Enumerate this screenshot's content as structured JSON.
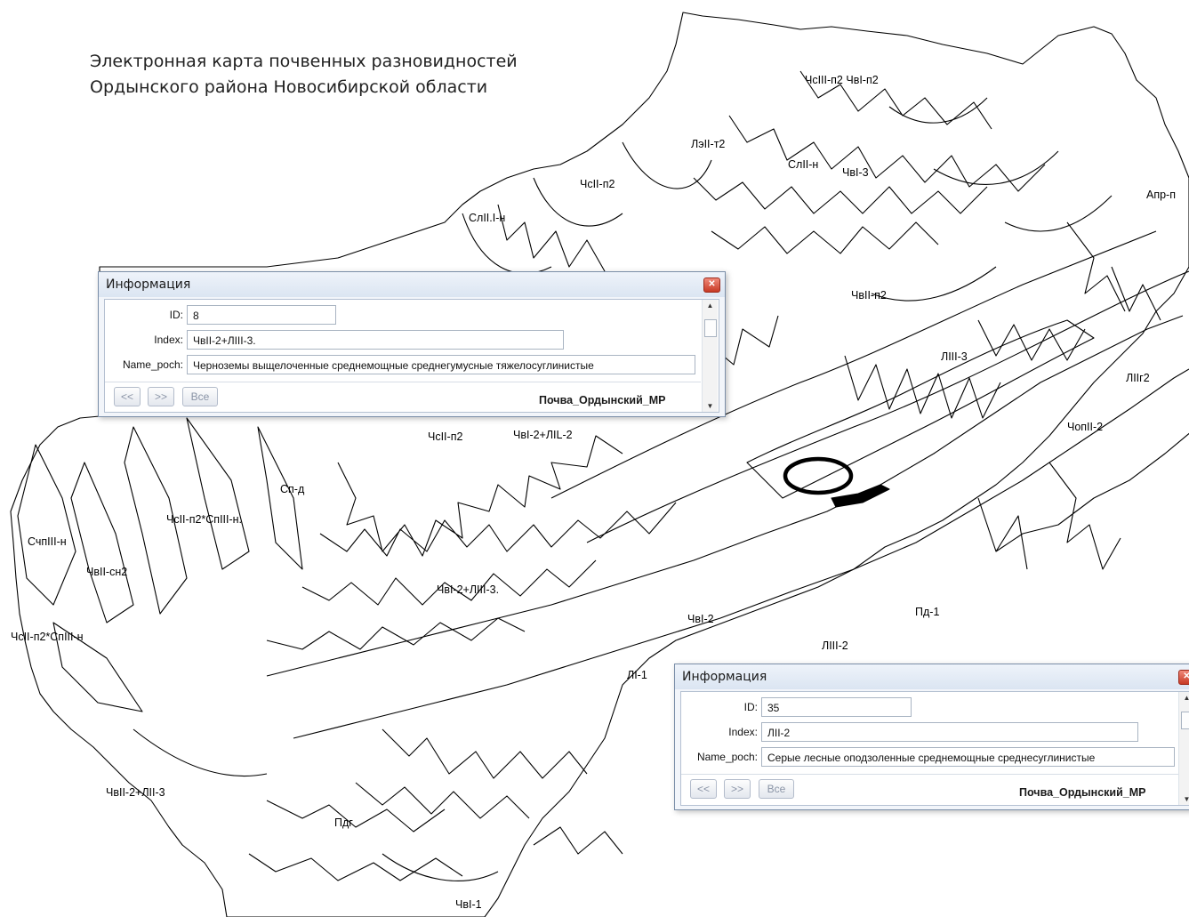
{
  "title": {
    "line1": "Электронная карта почвенных разновидностей",
    "line2": "Ордынского района Новосибирской области"
  },
  "map_labels": [
    {
      "id": "l1",
      "text": "ЧсIII-п2 ЧвI-п2"
    },
    {
      "id": "l2",
      "text": "ЛэII-т2"
    },
    {
      "id": "l3",
      "text": "СлII-н"
    },
    {
      "id": "l4",
      "text": "ЧвI-3"
    },
    {
      "id": "l5",
      "text": "ЧсII-п2"
    },
    {
      "id": "l6",
      "text": "Апр-п"
    },
    {
      "id": "l7",
      "text": "СлII.I-н"
    },
    {
      "id": "l8",
      "text": "ЧвII-п2"
    },
    {
      "id": "l9",
      "text": "ЛIII-3"
    },
    {
      "id": "l10",
      "text": "ЛIIг2"
    },
    {
      "id": "l11",
      "text": "ЧсII-п2"
    },
    {
      "id": "l12",
      "text": "ЧвI-2+ЛIL-2"
    },
    {
      "id": "l13",
      "text": "ЧопII-2"
    },
    {
      "id": "l14",
      "text": "Сп-д"
    },
    {
      "id": "l15",
      "text": "ЧсII-п2*СпIII-н."
    },
    {
      "id": "l16",
      "text": "СчпIII-н"
    },
    {
      "id": "l17",
      "text": "ЧвII-сн2"
    },
    {
      "id": "l18",
      "text": "ЧвI-2+ЛIII-3."
    },
    {
      "id": "l19",
      "text": "ЧвI-2"
    },
    {
      "id": "l20",
      "text": "Пд-1"
    },
    {
      "id": "l21",
      "text": "ЧсII-п2*СпIII-н"
    },
    {
      "id": "l22",
      "text": "ЛIII-2"
    },
    {
      "id": "l23",
      "text": "ЛI-1"
    },
    {
      "id": "l24",
      "text": "ЧвII-2+ЛII-3"
    },
    {
      "id": "l25",
      "text": "Пдг"
    },
    {
      "id": "l26",
      "text": "ЧвI-1"
    }
  ],
  "info_windows": [
    {
      "title": "Информация",
      "id_label": "ID:",
      "id_value": "8",
      "index_label": "Index:",
      "index_value": "ЧвII-2+ЛIII-3.",
      "name_label": "Name_poch:",
      "name_value": "Черноземы выщелоченные среднемощные среднегумусные тяжелосуглинистые",
      "btn_prev": "<<",
      "btn_next": ">>",
      "btn_all": "Все",
      "layer": "Почва_Ордынский_МР"
    },
    {
      "title": "Информация",
      "id_label": "ID:",
      "id_value": "35",
      "index_label": "Index:",
      "index_value": "ЛII-2",
      "name_label": "Name_poch:",
      "name_value": "Серые лесные оподзоленные среднемощные среднесуглинистые",
      "btn_prev": "<<",
      "btn_next": ">>",
      "btn_all": "Все",
      "layer": "Почва_Ордынский_МР"
    }
  ],
  "icons": {
    "close": "close-icon",
    "scroll_up": "scroll-up-icon",
    "scroll_down": "scroll-down-icon",
    "selection_marker": "ellipse-marker"
  },
  "colors": {
    "map_line": "#000000",
    "window_bg": "#f2f5fa",
    "close_button": "#c73a25"
  }
}
